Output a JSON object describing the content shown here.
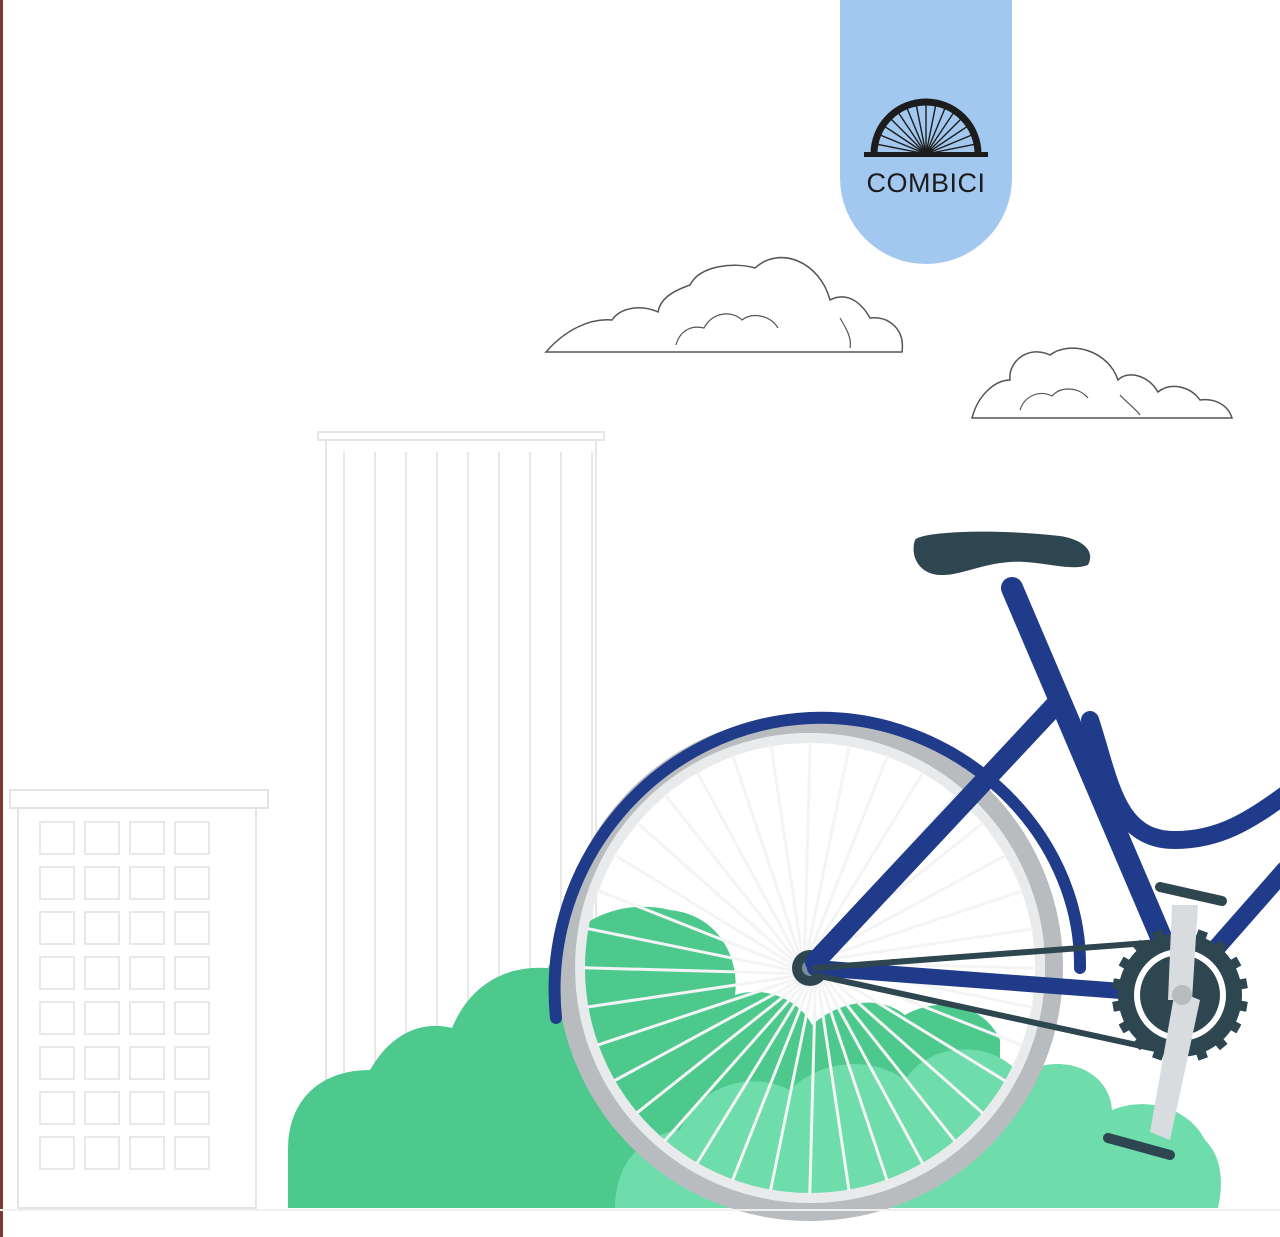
{
  "brand": {
    "name": "COMBICI",
    "tab_color": "#a3c8f0",
    "text_color": "#1c1c1c"
  },
  "colors": {
    "bike_frame": "#1f3b8a",
    "bike_frame_dark": "#142a6b",
    "saddle": "#2e4650",
    "wheel_rim": "#c8c8c8",
    "bush": "#4dc98e",
    "bush_light": "#6fdcab",
    "building_line": "#e6e6e6",
    "cloud_line": "#555555",
    "edge": "#7a3b2e"
  }
}
